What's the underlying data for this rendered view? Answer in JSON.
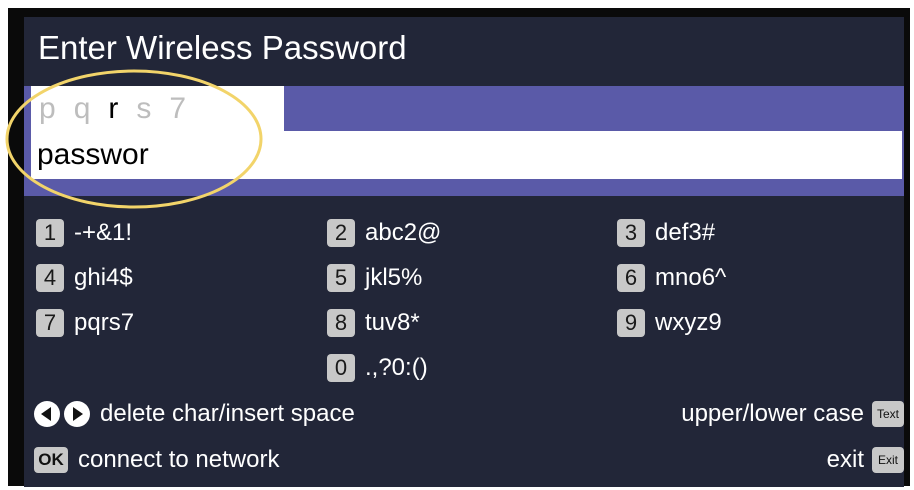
{
  "title": "Enter Wireless Password",
  "suggestions": [
    "p",
    "q",
    "r",
    "s",
    "7"
  ],
  "selected_suggestion": "r",
  "password_field_value": "passwor",
  "keys": [
    {
      "number": "1",
      "chars": "-+&1!"
    },
    {
      "number": "2",
      "chars": "abc2@"
    },
    {
      "number": "3",
      "chars": "def3#"
    },
    {
      "number": "4",
      "chars": "ghi4$"
    },
    {
      "number": "5",
      "chars": "jkl5%"
    },
    {
      "number": "6",
      "chars": "mno6^"
    },
    {
      "number": "7",
      "chars": "pqrs7"
    },
    {
      "number": "8",
      "chars": "tuv8*"
    },
    {
      "number": "9",
      "chars": "wxyz9"
    },
    {
      "number": "0",
      "chars": ".,?0:()"
    }
  ],
  "hints": {
    "delete_insert": "delete char/insert space",
    "connect": "connect to network",
    "case": "upper/lower case",
    "exit": "exit"
  },
  "buttons": {
    "ok": "OK",
    "text": "Text",
    "exit": "Exit"
  },
  "colors": {
    "panel": "#222638",
    "entry_bar": "#5a5aa8",
    "highlight_ring": "#f2d46a",
    "key_badge": "#c8c8c8"
  }
}
